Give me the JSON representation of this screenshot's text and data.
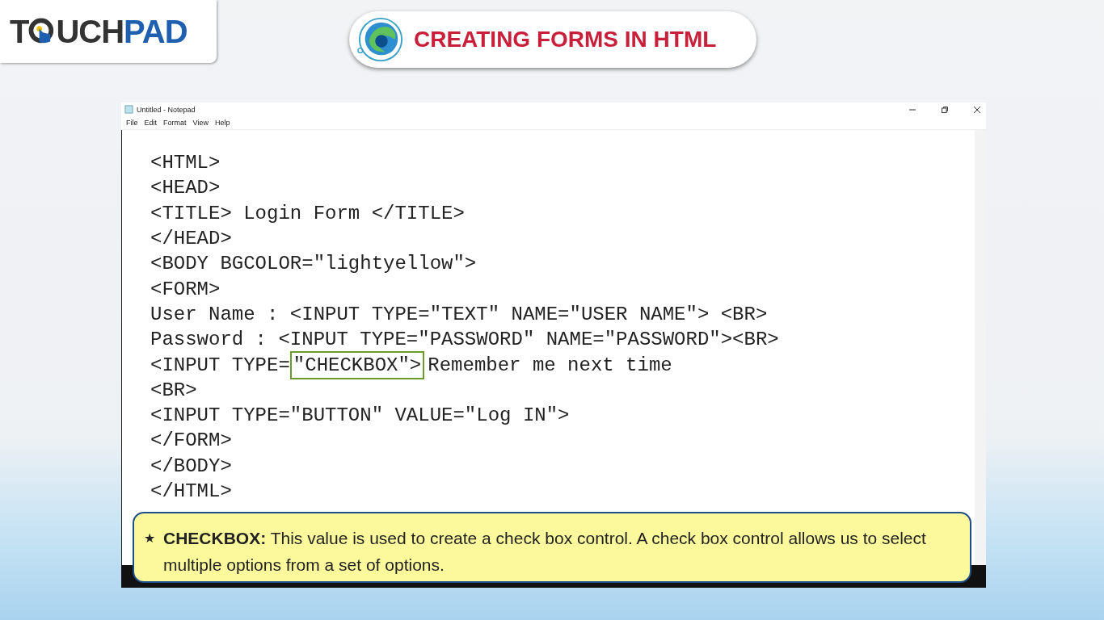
{
  "logo": {
    "lead": "T",
    "middle": "UCH",
    "accent": "PAD"
  },
  "banner": {
    "title": "CREATING FORMS IN HTML"
  },
  "window": {
    "title": "Untitled - Notepad",
    "menu": [
      "File",
      "Edit",
      "Format",
      "View",
      "Help"
    ]
  },
  "code_lines": [
    {
      "parts": [
        {
          "text": "<HTML>",
          "highlighted": false
        }
      ]
    },
    {
      "parts": [
        {
          "text": "<HEAD>",
          "highlighted": false
        }
      ]
    },
    {
      "parts": [
        {
          "text": "<TITLE> Login Form </TITLE>",
          "highlighted": false
        }
      ]
    },
    {
      "parts": [
        {
          "text": "</HEAD>",
          "highlighted": false
        }
      ]
    },
    {
      "parts": [
        {
          "text": "<BODY BGCOLOR=\"lightyellow\">",
          "highlighted": false
        }
      ]
    },
    {
      "parts": [
        {
          "text": "<FORM>",
          "highlighted": false
        }
      ]
    },
    {
      "parts": [
        {
          "text": "User Name : <INPUT TYPE=\"TEXT\" NAME=\"USER NAME\"> <BR>",
          "highlighted": false
        }
      ]
    },
    {
      "parts": [
        {
          "text": "Password : <INPUT TYPE=\"PASSWORD\" NAME=\"PASSWORD\"><BR>",
          "highlighted": false
        }
      ]
    },
    {
      "parts": [
        {
          "text": "<INPUT TYPE=",
          "highlighted": false
        },
        {
          "text": "\"CHECKBOX\">",
          "highlighted": true
        },
        {
          "text": "Remember me next time",
          "highlighted": false
        }
      ]
    },
    {
      "parts": [
        {
          "text": "<BR>",
          "highlighted": false
        }
      ]
    },
    {
      "parts": [
        {
          "text": "<INPUT TYPE=\"BUTTON\" VALUE=\"Log IN\">",
          "highlighted": false
        }
      ]
    },
    {
      "parts": [
        {
          "text": "</FORM>",
          "highlighted": false
        }
      ]
    },
    {
      "parts": [
        {
          "text": "</BODY>",
          "highlighted": false
        }
      ]
    },
    {
      "parts": [
        {
          "text": "</HTML>",
          "highlighted": false
        }
      ]
    }
  ],
  "callout": {
    "bullet": "★",
    "text": "**CHECKBOX:** This value is used to create a check box control. A check box control allows us to select multiple options from a set of options."
  }
}
